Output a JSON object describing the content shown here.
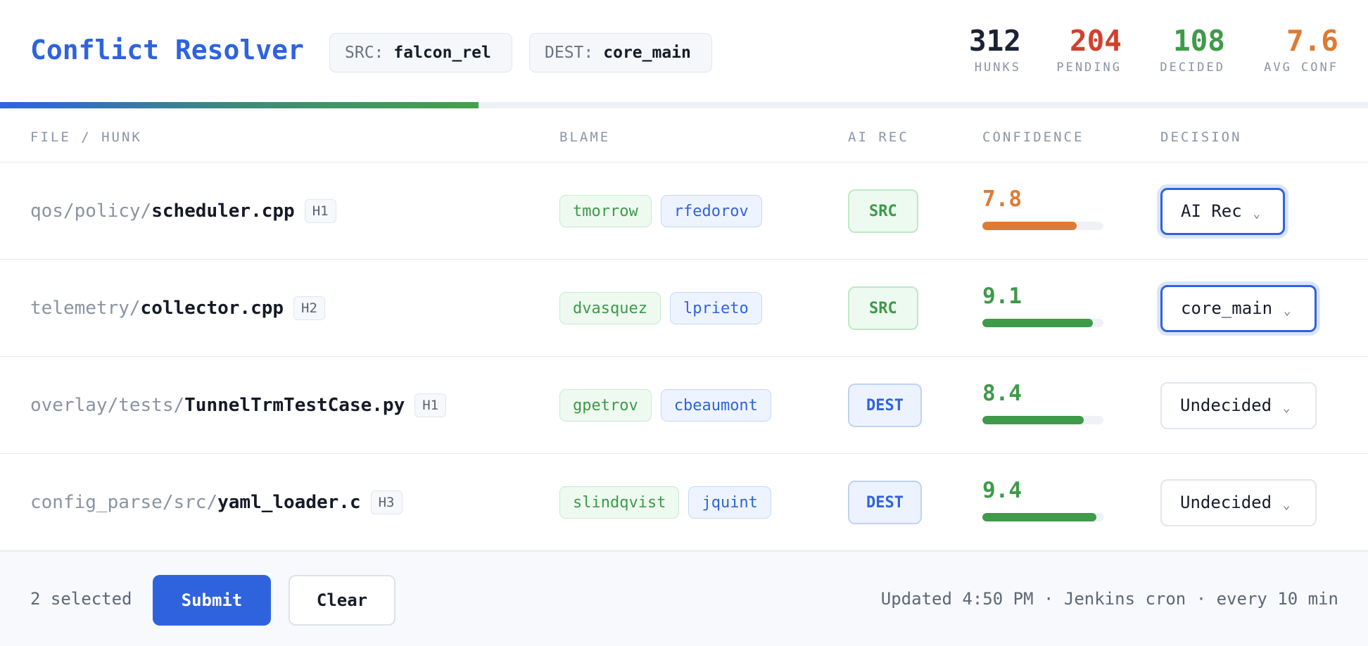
{
  "header": {
    "title": "Conflict Resolver",
    "src_label": "SRC:",
    "src_value": "falcon_rel",
    "dest_label": "DEST:",
    "dest_value": "core_main"
  },
  "stats": {
    "hunks": {
      "value": "312",
      "label": "HUNKS"
    },
    "pending": {
      "value": "204",
      "label": "PENDING"
    },
    "decided": {
      "value": "108",
      "label": "DECIDED"
    },
    "avg_conf": {
      "value": "7.6",
      "label": "AVG CONF"
    }
  },
  "progress_fraction": 0.35,
  "columns": {
    "file": "FILE / HUNK",
    "blame": "BLAME",
    "ai_rec": "AI REC",
    "confidence": "CONFIDENCE",
    "decision": "DECISION"
  },
  "rows": [
    {
      "dir": "qos/policy/",
      "name": "scheduler.cpp",
      "hunk": "H1",
      "blame": [
        "tmorrow",
        "rfedorov"
      ],
      "ai_rec": "SRC",
      "confidence": "7.8",
      "decision": "AI Rec"
    },
    {
      "dir": "telemetry/",
      "name": "collector.cpp",
      "hunk": "H2",
      "blame": [
        "dvasquez",
        "lprieto"
      ],
      "ai_rec": "SRC",
      "confidence": "9.1",
      "decision": "core_main"
    },
    {
      "dir": "overlay/tests/",
      "name": "TunnelTrmTestCase.py",
      "hunk": "H1",
      "blame": [
        "gpetrov",
        "cbeaumont"
      ],
      "ai_rec": "DEST",
      "confidence": "8.4",
      "decision": "Undecided"
    },
    {
      "dir": "config_parse/src/",
      "name": "yaml_loader.c",
      "hunk": "H3",
      "blame": [
        "slindqvist",
        "jquint"
      ],
      "ai_rec": "DEST",
      "confidence": "9.4",
      "decision": "Undecided"
    }
  ],
  "colors": {
    "accent": "#2f63de",
    "green": "#3f9a49",
    "orange": "#df7a33",
    "red": "#d2402c"
  },
  "footer": {
    "selected": "2 selected",
    "submit": "Submit",
    "clear": "Clear",
    "updated": "Updated 4:50 PM · Jenkins cron · every 10 min"
  }
}
